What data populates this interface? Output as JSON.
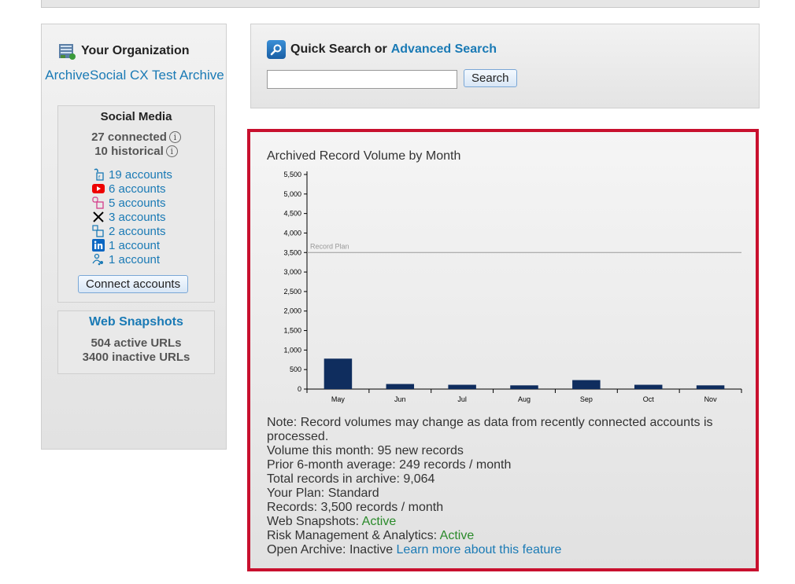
{
  "organization": {
    "header": "Your Organization",
    "name": "ArchiveSocial CX Test Archive"
  },
  "social_media": {
    "header": "Social Media",
    "connected": "27 connected",
    "historical": "10 historical",
    "info_glyph": "i",
    "accounts": [
      {
        "icon": "facebook-icon",
        "label": "19 accounts"
      },
      {
        "icon": "youtube-icon",
        "label": "6 accounts"
      },
      {
        "icon": "instagram-icon",
        "label": "5 accounts"
      },
      {
        "icon": "x-twitter-icon",
        "label": "3 accounts"
      },
      {
        "icon": "linkedin-page-icon",
        "label": "2 accounts"
      },
      {
        "icon": "linkedin-icon",
        "label": "1 account"
      },
      {
        "icon": "group-icon",
        "label": "1 account"
      }
    ],
    "connect_label": "Connect accounts"
  },
  "web_snapshots": {
    "header": "Web Snapshots",
    "active": "504 active URLs",
    "inactive": "3400 inactive URLs"
  },
  "search": {
    "quick_label": "Quick Search or",
    "advanced_label": "Advanced Search",
    "input_value": "",
    "button_label": "Search"
  },
  "chart_data": {
    "type": "bar",
    "title": "Archived Record Volume by Month",
    "categories": [
      "May",
      "Jun",
      "Jul",
      "Aug",
      "Sep",
      "Oct",
      "Nov"
    ],
    "values": [
      780,
      130,
      110,
      95,
      230,
      110,
      95
    ],
    "ylim": [
      0,
      5500
    ],
    "yticks": [
      "0",
      "500",
      "1,000",
      "1,500",
      "2,000",
      "2,500",
      "3,000",
      "3,500",
      "4,000",
      "4,500",
      "5,000",
      "5,500"
    ],
    "reference_line": {
      "label": "Record Plan",
      "value": 3500
    },
    "bar_color": "#0f2d5e"
  },
  "notes": {
    "note": "Note: Record volumes may change as data from recently connected accounts is processed.",
    "volume": "Volume this month: 95 new records",
    "prior": "Prior 6-month average: 249 records / month",
    "total": "Total records in archive: 9,064",
    "plan": "Your Plan: Standard",
    "records": "Records: 3,500 records / month",
    "web_label": "Web Snapshots: ",
    "web_status": "Active",
    "risk_label": "Risk Management & Analytics: ",
    "risk_status": "Active",
    "open_label": "Open Archive: Inactive ",
    "open_link": "Learn more about this feature"
  },
  "colors": {
    "link": "#1a7ab5",
    "active": "#2a8a2a",
    "highlight_border": "#c8102e"
  }
}
